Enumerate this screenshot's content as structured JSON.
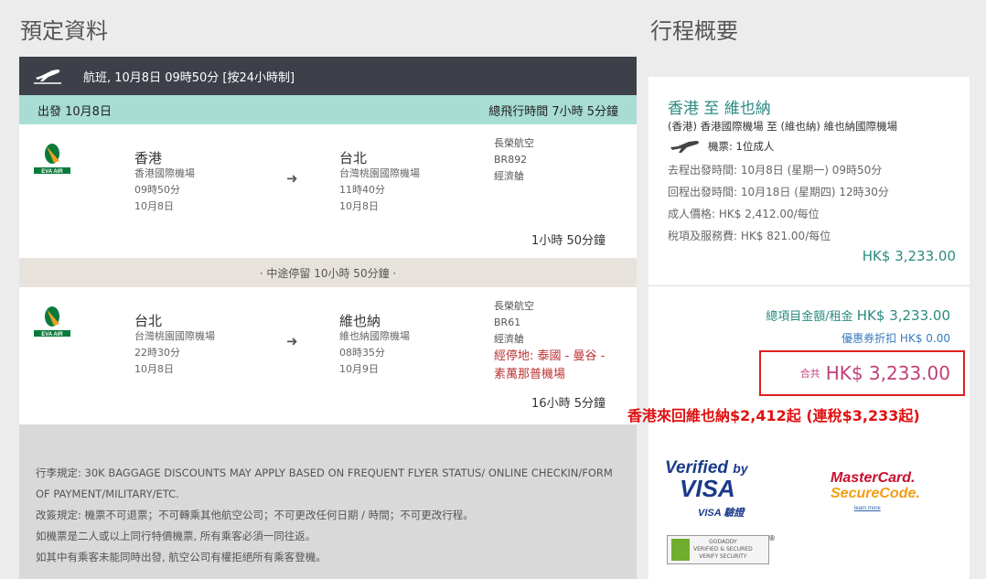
{
  "titles": {
    "booking": "預定資料",
    "summary": "行程概要"
  },
  "header": {
    "flight_info": "航班, 10月8日 09時50分 [按24小時制]",
    "departure": "出發 10月8日",
    "total_time": "總飛行時間 7小時 5分鐘"
  },
  "segments": [
    {
      "from_city": "香港",
      "from_airport": "香港國際機場",
      "dep_time": "09時50分",
      "dep_date": "10月8日",
      "to_city": "台北",
      "to_airport": "台灣桃園國際機場",
      "arr_time": "11時40分",
      "arr_date": "10月8日",
      "airline": "長榮航空",
      "flight_no": "BR892",
      "cabin": "經濟艙",
      "duration": "1小時 50分鐘",
      "arrow": "➜"
    },
    {
      "from_city": "台北",
      "from_airport": "台灣桃園國際機場",
      "dep_time": "22時30分",
      "dep_date": "10月8日",
      "to_city": "維也納",
      "to_airport": "維也納國際機場",
      "arr_time": "08時35分",
      "arr_date": "10月9日",
      "airline": "長榮航空",
      "flight_no": "BR61",
      "cabin": "經濟艙",
      "stop_1": "經停地: 泰國 - 曼谷 -",
      "stop_2": "素萬那普機場",
      "duration": "16小時 5分鐘",
      "arrow": "➜"
    }
  ],
  "layover": "· 中途停留 10小時 50分鐘 ·",
  "notes": [
    "行李規定: 30K BAGGAGE DISCOUNTS MAY APPLY BASED ON FREQUENT FLYER STATUS/ ONLINE CHECKIN/FORM",
    "OF PAYMENT/MILITARY/ETC.",
    "改簽規定: 機票不可退票；不可轉乘其他航空公司；不可更改任何日期 / 時間；不可更改行程。",
    "如機票是二人或以上同行特價機票, 所有乘客必須一同往返。",
    "如其中有乘客未能同時出發, 航空公司有權拒絕所有乘客登機。"
  ],
  "summary": {
    "route": "香港  至  維也納",
    "airports": "(香港) 香港國際機場  至  (維也納) 維也納國際機場",
    "tickets": "機票: 1位成人",
    "outbound": "去程出發時間: 10月8日 (星期一) 09時50分",
    "return": "回程出發時間: 10月18日 (星期四) 12時30分",
    "adult_price": "成人價格: HK$ 2,412.00/每位",
    "tax": "稅項及服務費: HK$ 821.00/每位",
    "subtotal": "HK$ 3,233.00",
    "total_label": "總項目金額/租金",
    "total_value": "HK$ 3,233.00",
    "coupon": "優惠券折扣 HK$ 0.00",
    "grand_label": "合共",
    "grand_value": "HK$ 3,233.00"
  },
  "promo": "香港來回維也納$2,412起 (連稅$3,233起)",
  "badges": {
    "visa_line1": "Verified",
    "visa_by": "by",
    "visa_line2": "VISA",
    "visa_line3": "VISA 驗證",
    "mc_line1": "MasterCard.",
    "mc_line2": "SecureCode.",
    "mc_learn": "learn more",
    "godaddy_1": "GODADDY",
    "godaddy_2": "VERIFIED & SECURED",
    "godaddy_3": "VERIFY SECURITY",
    "godaddy_reg": "®"
  },
  "colors": {
    "accent": "#2a8a80",
    "header_bg": "#3d3f49",
    "departure_bar": "#a8ddd3",
    "alert": "#e02020"
  },
  "icons": {
    "header": "airplane-icon",
    "airline": "eva-air-logo",
    "route": "arrow-right-icon",
    "tickets": "airplane-icon"
  }
}
